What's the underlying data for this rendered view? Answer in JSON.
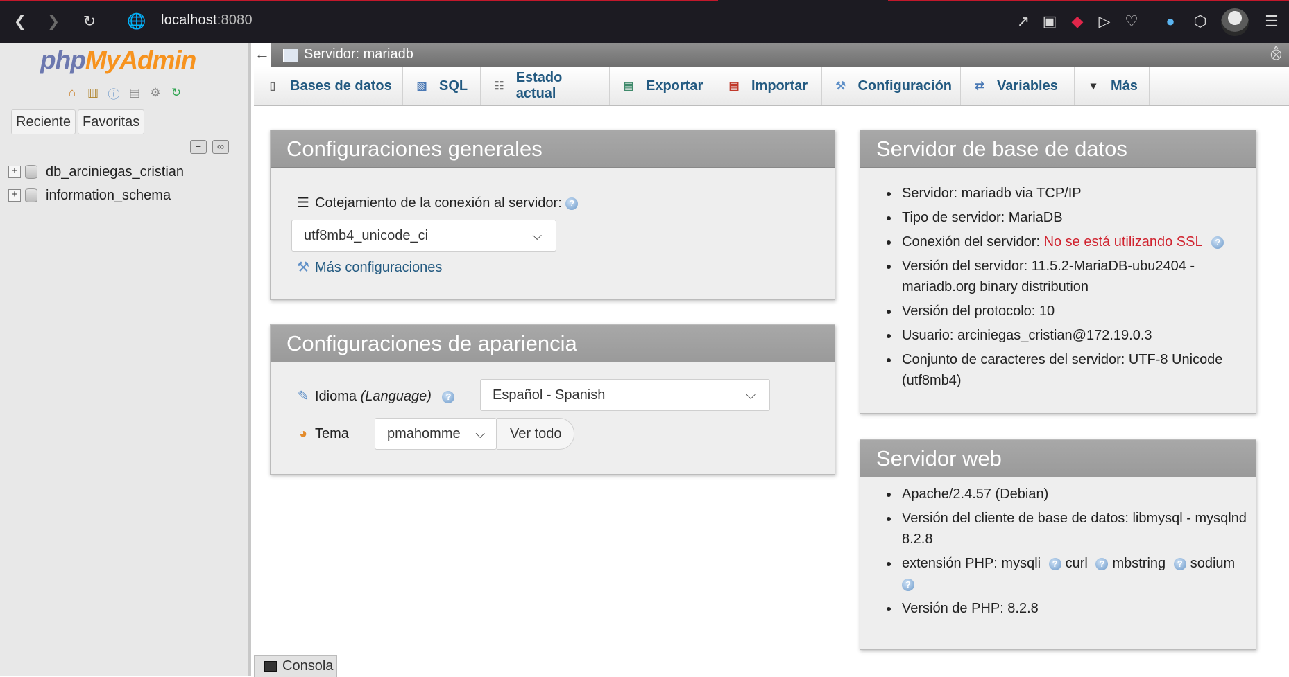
{
  "browser": {
    "url_host": "localhost",
    "url_port": ":8080"
  },
  "nav": {
    "logo_php": "php",
    "logo_my": "My",
    "logo_admin": "Admin",
    "tab_recent": "Reciente",
    "tab_favorites": "Favoritas",
    "databases": [
      {
        "name": "db_arciniegas_cristian"
      },
      {
        "name": "information_schema"
      }
    ]
  },
  "server_bar": {
    "label": "Servidor: mariadb"
  },
  "tabs": [
    {
      "label": "Bases de datos",
      "icon": "database-icon"
    },
    {
      "label": "SQL",
      "icon": "sql-icon"
    },
    {
      "label": "Estado actual",
      "icon": "status-icon"
    },
    {
      "label": "Exportar",
      "icon": "export-icon"
    },
    {
      "label": "Importar",
      "icon": "import-icon"
    },
    {
      "label": "Configuración",
      "icon": "wrench-icon"
    },
    {
      "label": "Variables",
      "icon": "variables-icon"
    },
    {
      "label": "Más",
      "icon": "caret-down-icon"
    }
  ],
  "general": {
    "title": "Configuraciones generales",
    "collation_label": "Cotejamiento de la conexión al servidor:",
    "collation_value": "utf8mb4_unicode_ci",
    "more_settings": "Más configuraciones"
  },
  "appearance": {
    "title": "Configuraciones de apariencia",
    "language_label": "Idioma",
    "language_label_italic": "(Language)",
    "language_value": "Español - Spanish",
    "theme_label": "Tema",
    "theme_value": "pmahomme",
    "view_all": "Ver todo"
  },
  "db_server": {
    "title": "Servidor de base de datos",
    "server": "Servidor: mariadb via TCP/IP",
    "type": "Tipo de servidor: MariaDB",
    "connection_label": "Conexión del servidor:",
    "connection_value": "No se está utilizando SSL",
    "version_line1": "Versión del servidor: 11.5.2-MariaDB-ubu2404 -",
    "version_line2": "mariadb.org binary distribution",
    "protocol": "Versión del protocolo: 10",
    "user": "Usuario: arciniegas_cristian@172.19.0.3",
    "charset_line1": "Conjunto de caracteres del servidor: UTF-8 Unicode",
    "charset_line2": "(utf8mb4)"
  },
  "web_server": {
    "title": "Servidor web",
    "apache": "Apache/2.4.57 (Debian)",
    "client_line1": "Versión del cliente de base de datos: libmysql - mysqlnd",
    "client_line2": "8.2.8",
    "ext_label": "extensión PHP: mysqli",
    "ext_curl": "curl",
    "ext_mbstring": "mbstring",
    "ext_sodium": "sodium",
    "php_version": "Versión de PHP: 8.2.8"
  },
  "console": {
    "label": "Consola"
  }
}
